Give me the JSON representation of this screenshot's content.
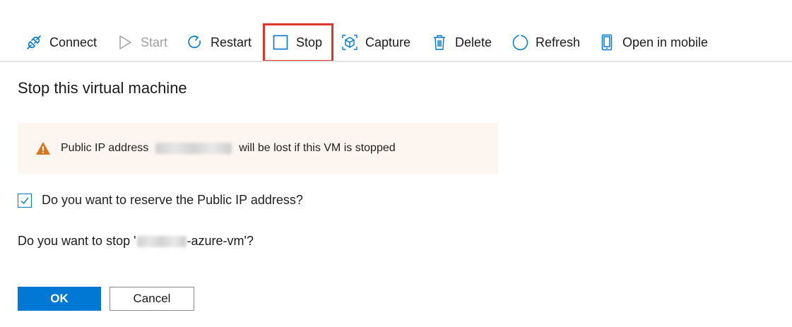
{
  "toolbar": {
    "items": [
      {
        "label": "Connect",
        "icon": "plug-icon",
        "enabled": true
      },
      {
        "label": "Start",
        "icon": "play-icon",
        "enabled": false
      },
      {
        "label": "Restart",
        "icon": "restart-icon",
        "enabled": true
      },
      {
        "label": "Stop",
        "icon": "stop-icon",
        "enabled": true,
        "highlighted": true
      },
      {
        "label": "Capture",
        "icon": "capture-icon",
        "enabled": true
      },
      {
        "label": "Delete",
        "icon": "trash-icon",
        "enabled": true
      },
      {
        "label": "Refresh",
        "icon": "refresh-icon",
        "enabled": true
      },
      {
        "label": "Open in mobile",
        "icon": "mobile-icon",
        "enabled": true
      }
    ]
  },
  "dialog": {
    "title": "Stop this virtual machine",
    "warning": {
      "prefix": "Public IP address",
      "suffix": "will be lost if this VM is stopped",
      "icon": "warning-icon"
    },
    "reserve_ip": {
      "label": "Do you want to reserve the Public IP address?",
      "checked": true
    },
    "confirm_question": {
      "prefix": "Do you want to stop '",
      "suffix": "-azure-vm'?"
    },
    "ok_label": "OK",
    "cancel_label": "Cancel"
  },
  "colors": {
    "accent": "#0078d4",
    "highlight_border": "#e2352a",
    "warning_bg": "#fdf6f0",
    "warning_icon": "#d9751f"
  }
}
